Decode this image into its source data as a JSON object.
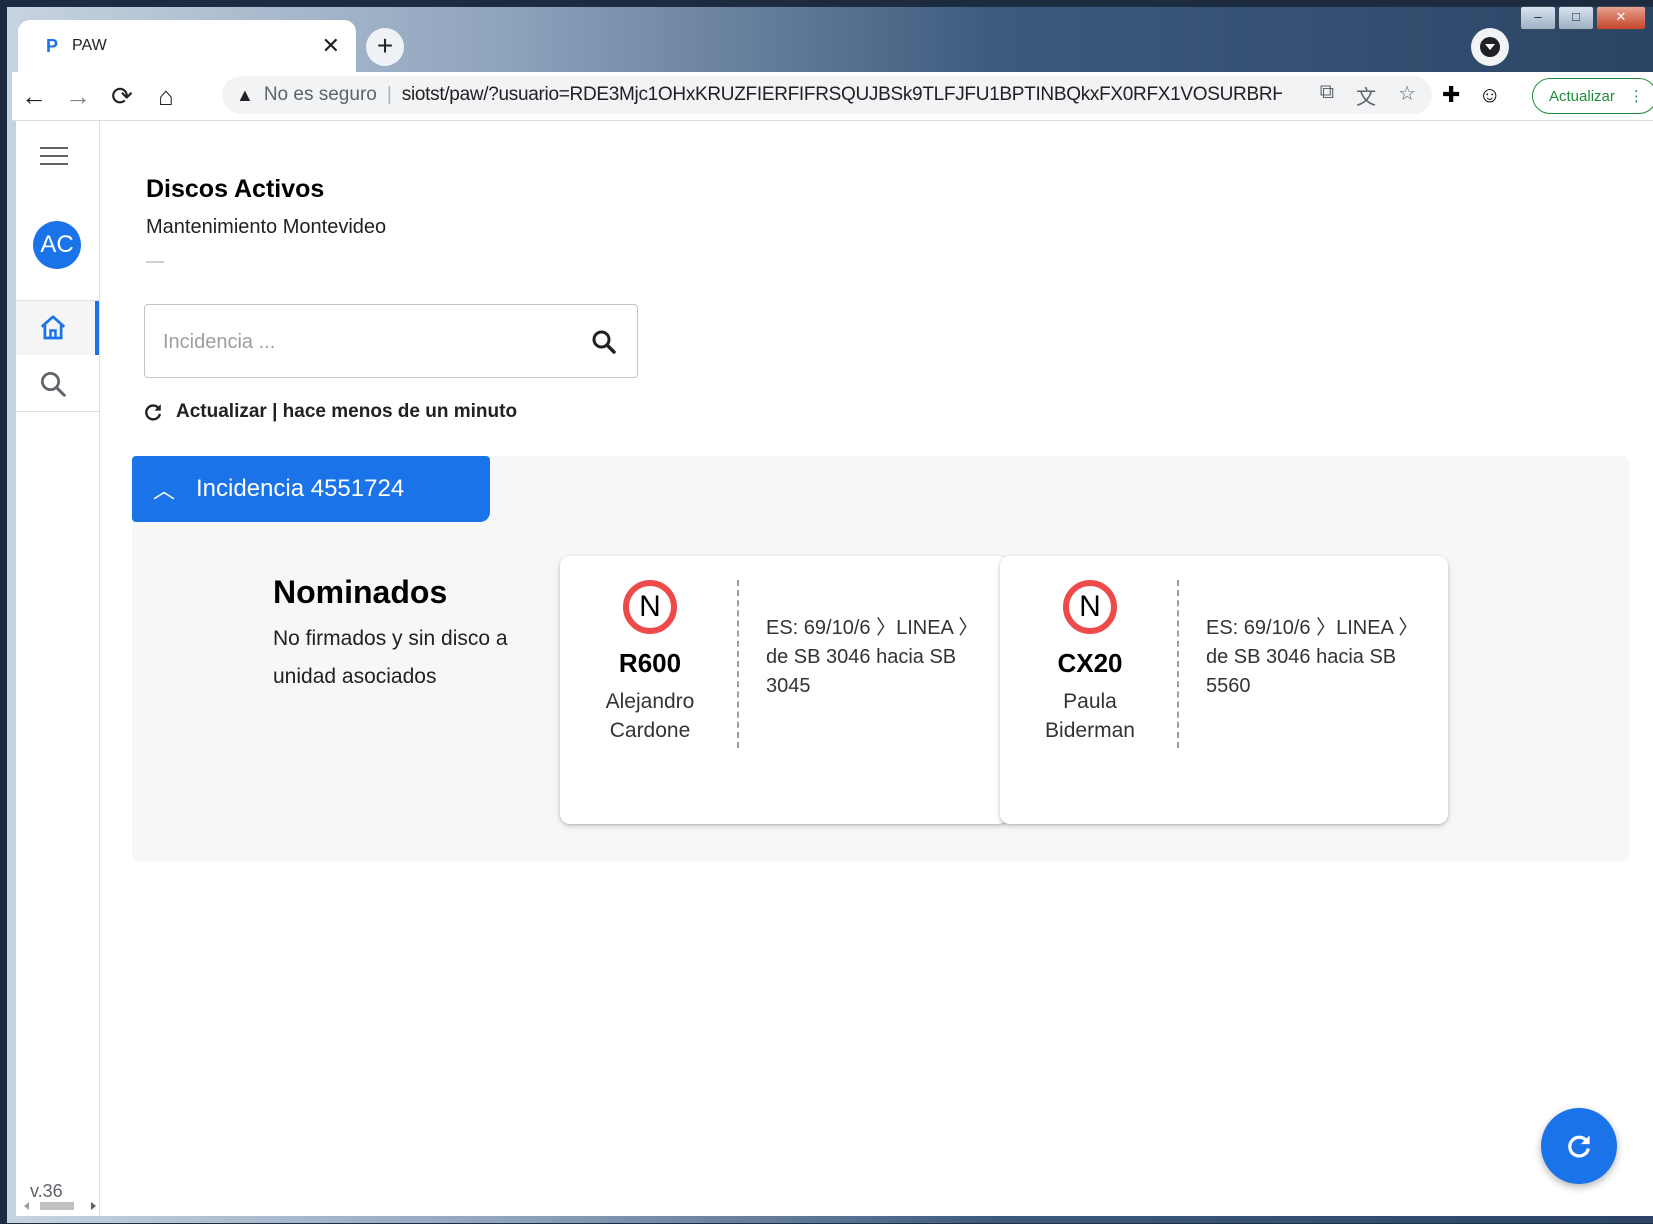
{
  "browser": {
    "tab_title": "PAW",
    "tab_favicon": "P",
    "close_glyph": "✕",
    "new_tab_glyph": "+",
    "security_label": "No es seguro",
    "url": "siotst/paw/?usuario=RDE3Mjc1OHxKRUZFIERFIFRSQUJBSk9TLFJFU1BPTINBQkxFX0RFX1VOSURBRHx8...",
    "update_label": "Actualizar",
    "accent_color": "#1a73e8"
  },
  "sidebar": {
    "avatar_initials": "AC",
    "items": [
      {
        "name": "home",
        "icon": "home-icon",
        "active": true
      },
      {
        "name": "search",
        "icon": "search-icon",
        "active": false
      }
    ],
    "version": "v.36"
  },
  "header": {
    "title": "Discos Activos",
    "subtitle": "Mantenimiento Montevideo"
  },
  "search": {
    "placeholder": "Incidencia ..."
  },
  "refresh": {
    "label": "Actualizar | hace menos de un minuto"
  },
  "incident": {
    "label": "Incidencia 4551724",
    "expanded": true,
    "section_title": "Nominados",
    "section_subtitle": "No firmados y sin disco a unidad asociados",
    "cards": [
      {
        "badge": "N",
        "code": "R600",
        "person": "Alejandro Cardone",
        "description": "ES: 69/10/6 〉LINEA 〉de SB 3046 hacia SB 3045"
      },
      {
        "badge": "N",
        "code": "CX20",
        "person": "Paula Biderman",
        "description": "ES: 69/10/6 〉LINEA 〉de SB 3046 hacia SB 5560"
      }
    ]
  }
}
